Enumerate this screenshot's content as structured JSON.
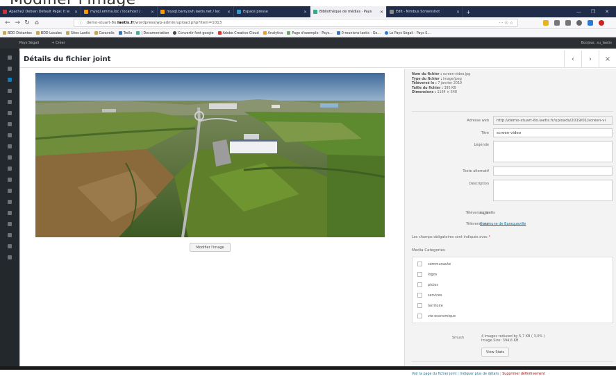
{
  "page_heading": "Modifier l'image",
  "browser": {
    "tabs": [
      {
        "label": "Apache2 Debian Default Page: It w",
        "fav": "#c33"
      },
      {
        "label": "mysql.emma.loc / localhost / :",
        "fav": "#f90"
      },
      {
        "label": "mysql.barry.ovh.laetis.net / loc",
        "fav": "#f90"
      },
      {
        "label": "Espace presse",
        "fav": "#39c"
      },
      {
        "label": "Bibliothèque de médias · Pays",
        "fav": "#3a8"
      },
      {
        "label": "Edit - Nimbus Screenshot",
        "fav": "#888"
      }
    ],
    "new_tab": "+",
    "url_prefix": "demo-stuart-8o.",
    "url_domain": "laetis.fr",
    "url_path": "/wordpress/wp-admin/upload.php?item=1013",
    "url_actions": "··· ☉ ☆",
    "bookmarks": [
      {
        "label": "BDD Distantes",
        "color": "#c9a64e"
      },
      {
        "label": "BDD Locales",
        "color": "#c9a64e"
      },
      {
        "label": "Sites Laetis",
        "color": "#c9a64e"
      },
      {
        "label": "Caravelis",
        "color": "#c9a64e"
      },
      {
        "label": "Trello",
        "color": "#2a7ad5"
      },
      {
        "label": "| Documentation",
        "color": "#4a9"
      },
      {
        "label": "Convertir font google",
        "color": "#444"
      },
      {
        "label": "Adobe Creative Cloud",
        "color": "#d33"
      },
      {
        "label": "Analytics",
        "color": "#e8a317"
      },
      {
        "label": "Page d'exemple - Pays...",
        "color": "#6a6"
      },
      {
        "label": "0-reunions-laetis - Go...",
        "color": "#2a7ad5"
      },
      {
        "label": "Le Pays Ségali - Pays S...",
        "color": "#2a7ad5"
      }
    ]
  },
  "adminbar": {
    "site_name": "Pays Ségali",
    "new_label": "+ Créer",
    "greeting": "Bonjour, su_laetis"
  },
  "modal": {
    "title": "Détails du fichier joint",
    "prev": "‹",
    "next": "›",
    "close": "×",
    "modify_button": "Modifier l'image"
  },
  "fileinfo": {
    "name_label": "Nom du fichier :",
    "name": "screen-video.jpg",
    "type_label": "Type du fichier :",
    "type": "image/jpeg",
    "uploaded_label": "Téléversé le :",
    "uploaded": "7 janvier 2019",
    "size_label": "Taille du fichier :",
    "size": "395 KB",
    "dims_label": "Dimensions :",
    "dims": "1164 × 548"
  },
  "fields": {
    "url_label": "Adresse web",
    "url_value": "http://demo-stuart-8o.laetis.fr/uploads/2019/01/screen-vi",
    "title_label": "Titre",
    "title_value": "screen-video",
    "caption_label": "Légende",
    "caption_value": "",
    "alt_label": "Texte alternatif",
    "alt_value": "",
    "desc_label": "Description",
    "desc_value": "",
    "uploaded_by_label": "Téléversé par",
    "uploaded_by": "su_laetis",
    "uploaded_on_label": "Téléversé sur",
    "uploaded_on": "Commune de Baraqueville"
  },
  "required_note": "Les champs obligatoires sont indiqués avec",
  "required_star": "*",
  "media_categories": {
    "title": "Media Categories",
    "items": [
      "communaute",
      "logos",
      "pictos",
      "services",
      "territoire",
      "vie-economique"
    ]
  },
  "smush": {
    "label": "Smush",
    "line1": "4 images reduced by 5,7 KB ( 3,0% )",
    "line2": "Image Size: 394,6 KB",
    "button": "View Stats"
  },
  "actions": {
    "view": "Voir la page du fichier joint",
    "more": "Indiquer plus de détails",
    "delete": "Supprimer définitivement",
    "sep": " | "
  }
}
